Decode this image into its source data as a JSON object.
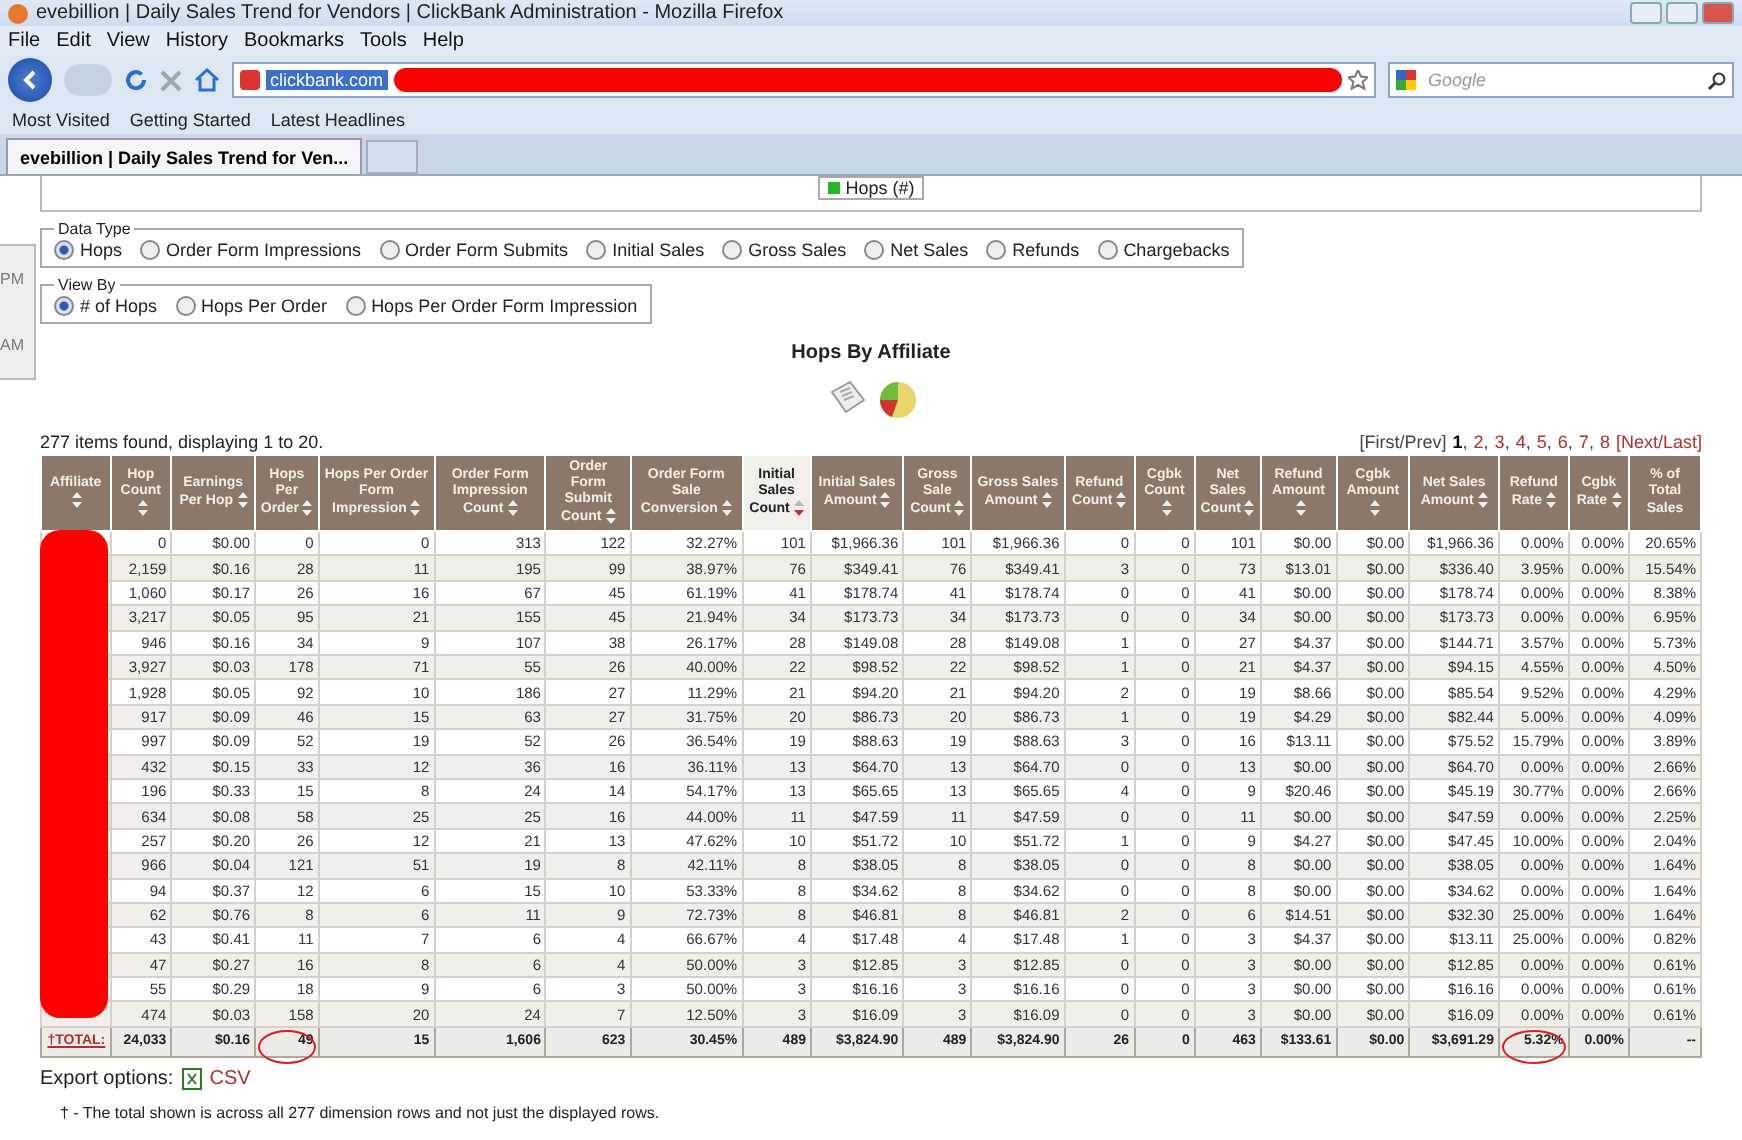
{
  "window": {
    "title": "evebillion | Daily Sales Trend for Vendors | ClickBank Administration - Mozilla Firefox"
  },
  "menu": [
    "File",
    "Edit",
    "View",
    "History",
    "Bookmarks",
    "Tools",
    "Help"
  ],
  "address": {
    "value": "clickbank.com"
  },
  "search": {
    "placeholder": "Google"
  },
  "bookmarks": [
    "Most Visited",
    "Getting Started",
    "Latest Headlines"
  ],
  "tabs": [
    {
      "label": "evebillion | Daily Sales Trend for Ven...",
      "selected": true
    }
  ],
  "side_panel": {
    "texts": [
      "PM",
      "AM"
    ]
  },
  "chart_legend": {
    "label": "Hops (#)",
    "color": "#22bb22"
  },
  "data_type": {
    "legend": "Data Type",
    "options": [
      {
        "label": "Hops",
        "selected": true
      },
      {
        "label": "Order Form Impressions",
        "selected": false
      },
      {
        "label": "Order Form Submits",
        "selected": false
      },
      {
        "label": "Initial Sales",
        "selected": false
      },
      {
        "label": "Gross Sales",
        "selected": false
      },
      {
        "label": "Net Sales",
        "selected": false
      },
      {
        "label": "Refunds",
        "selected": false
      },
      {
        "label": "Chargebacks",
        "selected": false
      }
    ]
  },
  "view_by": {
    "legend": "View By",
    "options": [
      {
        "label": "# of Hops",
        "selected": true
      },
      {
        "label": "Hops Per Order",
        "selected": false
      },
      {
        "label": "Hops Per Order Form Impression",
        "selected": false
      }
    ]
  },
  "report_title": "Hops By Affiliate",
  "summary": "277 items found, displaying 1 to 20.",
  "pagination": {
    "first_prev": "[First/Prev]",
    "separator": ",",
    "pages": [
      {
        "label": "1",
        "selected": true
      },
      {
        "label": "2",
        "selected": false
      },
      {
        "label": "3",
        "selected": false
      },
      {
        "label": "4",
        "selected": false
      },
      {
        "label": "5",
        "selected": false
      },
      {
        "label": "6",
        "selected": false
      },
      {
        "label": "7",
        "selected": false
      },
      {
        "label": "8",
        "selected": false
      }
    ],
    "next_last": "[Next/Last]"
  },
  "table": {
    "columns": [
      {
        "label": "Affiliate",
        "sortable": true,
        "sorted": false
      },
      {
        "label": "Hop Count",
        "sortable": true,
        "sorted": false
      },
      {
        "label": "Earnings Per Hop",
        "sortable": true,
        "sorted": false
      },
      {
        "label": "Hops Per Order",
        "sortable": true,
        "sorted": false
      },
      {
        "label": "Hops Per Order Form Impression",
        "sortable": true,
        "sorted": false
      },
      {
        "label": "Order Form Impression Count",
        "sortable": true,
        "sorted": false
      },
      {
        "label": "Order Form Submit Count",
        "sortable": true,
        "sorted": false
      },
      {
        "label": "Order Form Sale Conversion",
        "sortable": true,
        "sorted": false
      },
      {
        "label": "Initial Sales Count",
        "sortable": true,
        "sorted": true
      },
      {
        "label": "Initial Sales Amount",
        "sortable": true,
        "sorted": false
      },
      {
        "label": "Gross Sale Count",
        "sortable": true,
        "sorted": false
      },
      {
        "label": "Gross Sales Amount",
        "sortable": true,
        "sorted": false
      },
      {
        "label": "Refund Count",
        "sortable": true,
        "sorted": false
      },
      {
        "label": "Cgbk Count",
        "sortable": true,
        "sorted": false
      },
      {
        "label": "Net Sales Count",
        "sortable": true,
        "sorted": false
      },
      {
        "label": "Refund Amount",
        "sortable": true,
        "sorted": false
      },
      {
        "label": "Cgbk Amount",
        "sortable": true,
        "sorted": false
      },
      {
        "label": "Net Sales Amount",
        "sortable": true,
        "sorted": false
      },
      {
        "label": "Refund Rate",
        "sortable": true,
        "sorted": false
      },
      {
        "label": "Cgbk Rate",
        "sortable": true,
        "sorted": false
      },
      {
        "label": "% of Total Sales",
        "sortable": false,
        "sorted": false
      }
    ],
    "rows": [
      [
        "",
        "0",
        "$0.00",
        "0",
        "0",
        "313",
        "122",
        "32.27%",
        "101",
        "$1,966.36",
        "101",
        "$1,966.36",
        "0",
        "0",
        "101",
        "$0.00",
        "$0.00",
        "$1,966.36",
        "0.00%",
        "0.00%",
        "20.65%"
      ],
      [
        "",
        "2,159",
        "$0.16",
        "28",
        "11",
        "195",
        "99",
        "38.97%",
        "76",
        "$349.41",
        "76",
        "$349.41",
        "3",
        "0",
        "73",
        "$13.01",
        "$0.00",
        "$336.40",
        "3.95%",
        "0.00%",
        "15.54%"
      ],
      [
        "",
        "1,060",
        "$0.17",
        "26",
        "16",
        "67",
        "45",
        "61.19%",
        "41",
        "$178.74",
        "41",
        "$178.74",
        "0",
        "0",
        "41",
        "$0.00",
        "$0.00",
        "$178.74",
        "0.00%",
        "0.00%",
        "8.38%"
      ],
      [
        "",
        "3,217",
        "$0.05",
        "95",
        "21",
        "155",
        "45",
        "21.94%",
        "34",
        "$173.73",
        "34",
        "$173.73",
        "0",
        "0",
        "34",
        "$0.00",
        "$0.00",
        "$173.73",
        "0.00%",
        "0.00%",
        "6.95%"
      ],
      [
        "",
        "946",
        "$0.16",
        "34",
        "9",
        "107",
        "38",
        "26.17%",
        "28",
        "$149.08",
        "28",
        "$149.08",
        "1",
        "0",
        "27",
        "$4.37",
        "$0.00",
        "$144.71",
        "3.57%",
        "0.00%",
        "5.73%"
      ],
      [
        "",
        "3,927",
        "$0.03",
        "178",
        "71",
        "55",
        "26",
        "40.00%",
        "22",
        "$98.52",
        "22",
        "$98.52",
        "1",
        "0",
        "21",
        "$4.37",
        "$0.00",
        "$94.15",
        "4.55%",
        "0.00%",
        "4.50%"
      ],
      [
        "",
        "1,928",
        "$0.05",
        "92",
        "10",
        "186",
        "27",
        "11.29%",
        "21",
        "$94.20",
        "21",
        "$94.20",
        "2",
        "0",
        "19",
        "$8.66",
        "$0.00",
        "$85.54",
        "9.52%",
        "0.00%",
        "4.29%"
      ],
      [
        "",
        "917",
        "$0.09",
        "46",
        "15",
        "63",
        "27",
        "31.75%",
        "20",
        "$86.73",
        "20",
        "$86.73",
        "1",
        "0",
        "19",
        "$4.29",
        "$0.00",
        "$82.44",
        "5.00%",
        "0.00%",
        "4.09%"
      ],
      [
        "",
        "997",
        "$0.09",
        "52",
        "19",
        "52",
        "26",
        "36.54%",
        "19",
        "$88.63",
        "19",
        "$88.63",
        "3",
        "0",
        "16",
        "$13.11",
        "$0.00",
        "$75.52",
        "15.79%",
        "0.00%",
        "3.89%"
      ],
      [
        "",
        "432",
        "$0.15",
        "33",
        "12",
        "36",
        "16",
        "36.11%",
        "13",
        "$64.70",
        "13",
        "$64.70",
        "0",
        "0",
        "13",
        "$0.00",
        "$0.00",
        "$64.70",
        "0.00%",
        "0.00%",
        "2.66%"
      ],
      [
        "",
        "196",
        "$0.33",
        "15",
        "8",
        "24",
        "14",
        "54.17%",
        "13",
        "$65.65",
        "13",
        "$65.65",
        "4",
        "0",
        "9",
        "$20.46",
        "$0.00",
        "$45.19",
        "30.77%",
        "0.00%",
        "2.66%"
      ],
      [
        "",
        "634",
        "$0.08",
        "58",
        "25",
        "25",
        "16",
        "44.00%",
        "11",
        "$47.59",
        "11",
        "$47.59",
        "0",
        "0",
        "11",
        "$0.00",
        "$0.00",
        "$47.59",
        "0.00%",
        "0.00%",
        "2.25%"
      ],
      [
        "",
        "257",
        "$0.20",
        "26",
        "12",
        "21",
        "13",
        "47.62%",
        "10",
        "$51.72",
        "10",
        "$51.72",
        "1",
        "0",
        "9",
        "$4.27",
        "$0.00",
        "$47.45",
        "10.00%",
        "0.00%",
        "2.04%"
      ],
      [
        "",
        "966",
        "$0.04",
        "121",
        "51",
        "19",
        "8",
        "42.11%",
        "8",
        "$38.05",
        "8",
        "$38.05",
        "0",
        "0",
        "8",
        "$0.00",
        "$0.00",
        "$38.05",
        "0.00%",
        "0.00%",
        "1.64%"
      ],
      [
        "",
        "94",
        "$0.37",
        "12",
        "6",
        "15",
        "10",
        "53.33%",
        "8",
        "$34.62",
        "8",
        "$34.62",
        "0",
        "0",
        "8",
        "$0.00",
        "$0.00",
        "$34.62",
        "0.00%",
        "0.00%",
        "1.64%"
      ],
      [
        "",
        "62",
        "$0.76",
        "8",
        "6",
        "11",
        "9",
        "72.73%",
        "8",
        "$46.81",
        "8",
        "$46.81",
        "2",
        "0",
        "6",
        "$14.51",
        "$0.00",
        "$32.30",
        "25.00%",
        "0.00%",
        "1.64%"
      ],
      [
        "",
        "43",
        "$0.41",
        "11",
        "7",
        "6",
        "4",
        "66.67%",
        "4",
        "$17.48",
        "4",
        "$17.48",
        "1",
        "0",
        "3",
        "$4.37",
        "$0.00",
        "$13.11",
        "25.00%",
        "0.00%",
        "0.82%"
      ],
      [
        "",
        "47",
        "$0.27",
        "16",
        "8",
        "6",
        "4",
        "50.00%",
        "3",
        "$12.85",
        "3",
        "$12.85",
        "0",
        "0",
        "3",
        "$0.00",
        "$0.00",
        "$12.85",
        "0.00%",
        "0.00%",
        "0.61%"
      ],
      [
        "",
        "55",
        "$0.29",
        "18",
        "9",
        "6",
        "3",
        "50.00%",
        "3",
        "$16.16",
        "3",
        "$16.16",
        "0",
        "0",
        "3",
        "$0.00",
        "$0.00",
        "$16.16",
        "0.00%",
        "0.00%",
        "0.61%"
      ],
      [
        "",
        "474",
        "$0.03",
        "158",
        "20",
        "24",
        "7",
        "12.50%",
        "3",
        "$16.09",
        "3",
        "$16.09",
        "0",
        "0",
        "3",
        "$0.00",
        "$0.00",
        "$16.09",
        "0.00%",
        "0.00%",
        "0.61%"
      ]
    ],
    "total": {
      "label": "†TOTAL:",
      "cells": [
        {
          "text": "24,033",
          "circled": false
        },
        {
          "text": "$0.16",
          "circled": false
        },
        {
          "text": "49",
          "circled": true
        },
        {
          "text": "15",
          "circled": false
        },
        {
          "text": "1,606",
          "circled": false
        },
        {
          "text": "623",
          "circled": false
        },
        {
          "text": "30.45%",
          "circled": false
        },
        {
          "text": "489",
          "circled": false
        },
        {
          "text": "$3,824.90",
          "circled": false
        },
        {
          "text": "489",
          "circled": false
        },
        {
          "text": "$3,824.90",
          "circled": false
        },
        {
          "text": "26",
          "circled": false
        },
        {
          "text": "0",
          "circled": false
        },
        {
          "text": "463",
          "circled": false
        },
        {
          "text": "$133.61",
          "circled": false
        },
        {
          "text": "$0.00",
          "circled": false
        },
        {
          "text": "$3,691.29",
          "circled": false
        },
        {
          "text": "5.32%",
          "circled": true
        },
        {
          "text": "0.00%",
          "circled": false
        },
        {
          "text": "--",
          "circled": false
        }
      ]
    }
  },
  "export": {
    "label": "Export options:",
    "link": "CSV"
  },
  "footnote": "† - The total shown is across all 277 dimension rows and not just the displayed rows."
}
